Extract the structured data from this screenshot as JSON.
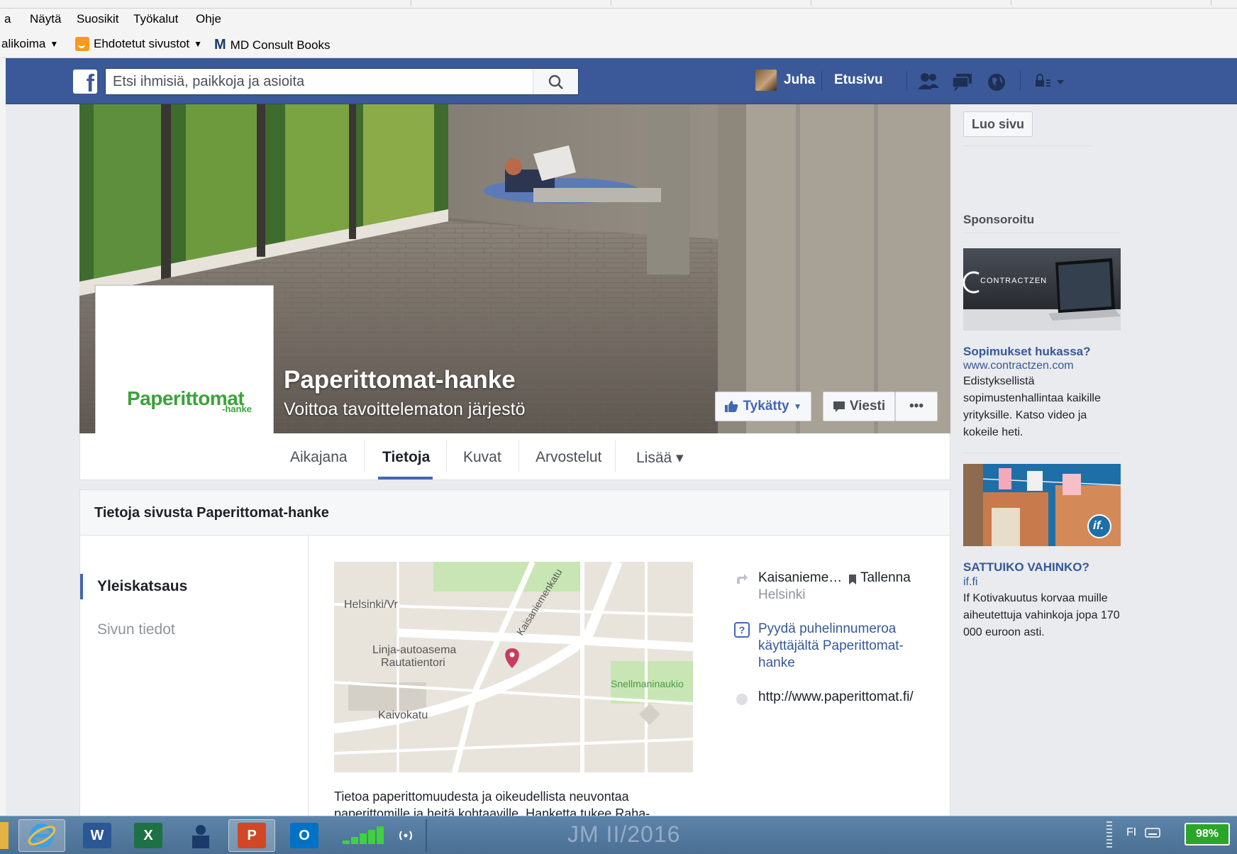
{
  "menu": {
    "items": [
      "a",
      "Näytä",
      "Suosikit",
      "Työkalut",
      "Ohje"
    ]
  },
  "favorites": {
    "gallery": "alikoima",
    "suggested": "Ehdotetut sivustot",
    "md_consult_m": "M",
    "md_consult": "MD Consult Books"
  },
  "fb": {
    "search_placeholder": "Etsi ihmisiä, paikkoja ja asioita",
    "user_name": "Juha",
    "home": "Etusivu",
    "logo": "f"
  },
  "page": {
    "name": "Paperittomat-hanke",
    "category": "Voittoa tavoittelematon järjestö",
    "logo_text": "Paperittomat",
    "logo_sub": "-hanke",
    "liked_label": "Tykätty",
    "message_label": "Viesti",
    "more_label": "•••",
    "tabs": [
      "Aikajana",
      "Tietoja",
      "Kuvat",
      "Arvostelut",
      "Lisää ▾"
    ]
  },
  "about": {
    "header": "Tietoja sivusta Paperittomat-hanke",
    "nav": [
      "Yleiskatsaus",
      "Sivun tiedot"
    ],
    "address": "Kaisanieme…",
    "save": "Tallenna",
    "city": "Helsinki",
    "phone_request": "Pyydä puhelinnumeroa käyttäjältä Paperittomat-hanke",
    "url": "http://www.paperittomat.fi/",
    "description": "Tietoa paperittomuudesta ja oikeudellista neuvontaa paperittomille ja heitä kohtaaville. Hanketta tukee Raha-",
    "map_labels": {
      "station": "Helsinki/Vr",
      "bus1": "Linja-autoasema",
      "bus2": "Rautatientori",
      "street1": "Kaisaniemenkatu",
      "square": "Snellmaninaukio",
      "street2": "Kaivokatu"
    }
  },
  "right": {
    "create_page": "Luo sivu",
    "sponsored": "Sponsoroitu",
    "ads": [
      {
        "image_brand": "CONTRACTZEN",
        "title": "Sopimukset hukassa?",
        "url": "www.contractzen.com",
        "text": "Edistyksellistä sopimustenhallintaa kaikille yrityksille. Katso video ja kokeile heti."
      },
      {
        "image_brand": "if.",
        "title": "SATTUIKO VAHINKO?",
        "url": "if.fi",
        "text": "If Kotivakuutus korvaa muille aiheutettuja vahinkoja jopa 170 000 euroon asti."
      }
    ]
  },
  "taskbar": {
    "word": "W",
    "excel": "X",
    "powerpoint": "P",
    "outlook": "O",
    "watermark": "JM II/2016",
    "lang": "FI",
    "battery": "98%"
  },
  "colors": {
    "fb_blue": "#3b5998",
    "link": "#365899",
    "accent": "#4267b2",
    "taskbar": "#5d84a9"
  }
}
